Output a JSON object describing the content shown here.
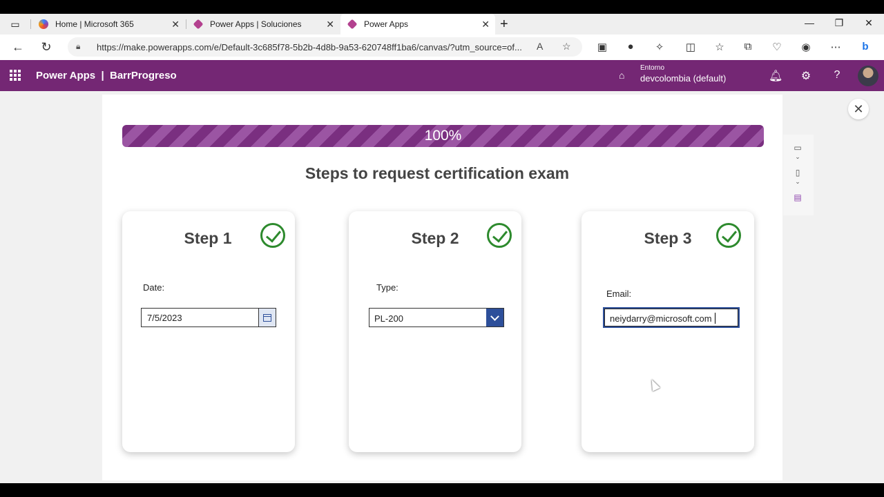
{
  "browser": {
    "tabs": [
      {
        "label": "Home | Microsoft 365",
        "icon": "m365-icon"
      },
      {
        "label": "Power Apps | Soluciones",
        "icon": "powerapps-icon"
      },
      {
        "label": "Power Apps",
        "icon": "powerapps-icon"
      }
    ],
    "url": "https://make.powerapps.com/e/Default-3c685f78-5b2b-4d8b-9a53-620748ff1ba6/canvas/?utm_source=of..."
  },
  "header": {
    "app_name": "Power Apps  |  BarrProgreso",
    "env_label": "Entorno",
    "env_name": "devcolombia (default)"
  },
  "progress": {
    "value": 1.0,
    "label": "100%",
    "colors": {
      "dark": "#7a2f80",
      "light": "#9b55a3"
    }
  },
  "title": "Steps to request certification exam",
  "steps": [
    {
      "title": "Step 1",
      "field_label": "Date:",
      "value": "7/5/2023",
      "completed": true
    },
    {
      "title": "Step 2",
      "field_label": "Type:",
      "value": "PL-200",
      "completed": true
    },
    {
      "title": "Step 3",
      "field_label": "Email:",
      "value": "neiydarry@microsoft.com",
      "completed": true
    }
  ],
  "colors": {
    "header_bg": "#742774",
    "check": "#2d8a2d",
    "accent": "#2d4f9a"
  }
}
